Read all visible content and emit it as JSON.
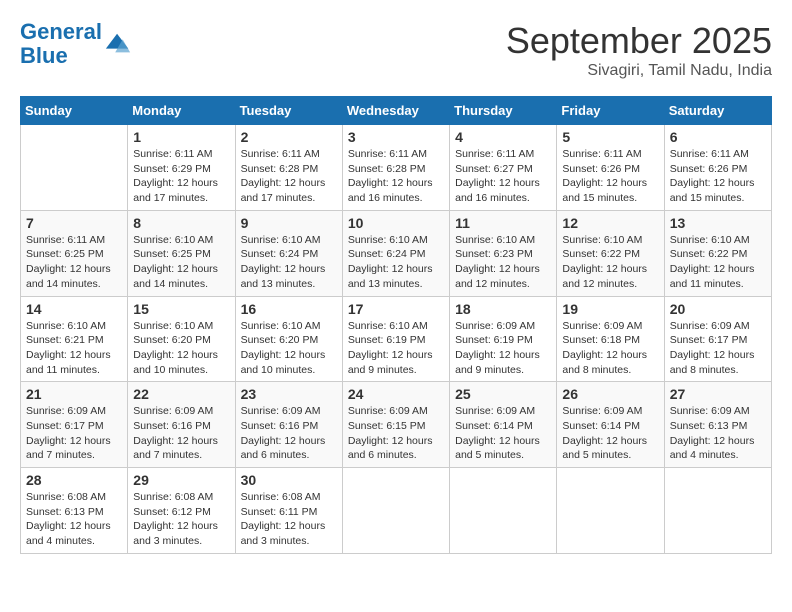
{
  "logo": {
    "line1": "General",
    "line2": "Blue"
  },
  "title": "September 2025",
  "subtitle": "Sivagiri, Tamil Nadu, India",
  "headers": [
    "Sunday",
    "Monday",
    "Tuesday",
    "Wednesday",
    "Thursday",
    "Friday",
    "Saturday"
  ],
  "weeks": [
    [
      {
        "day": "",
        "info": ""
      },
      {
        "day": "1",
        "info": "Sunrise: 6:11 AM\nSunset: 6:29 PM\nDaylight: 12 hours\nand 17 minutes."
      },
      {
        "day": "2",
        "info": "Sunrise: 6:11 AM\nSunset: 6:28 PM\nDaylight: 12 hours\nand 17 minutes."
      },
      {
        "day": "3",
        "info": "Sunrise: 6:11 AM\nSunset: 6:28 PM\nDaylight: 12 hours\nand 16 minutes."
      },
      {
        "day": "4",
        "info": "Sunrise: 6:11 AM\nSunset: 6:27 PM\nDaylight: 12 hours\nand 16 minutes."
      },
      {
        "day": "5",
        "info": "Sunrise: 6:11 AM\nSunset: 6:26 PM\nDaylight: 12 hours\nand 15 minutes."
      },
      {
        "day": "6",
        "info": "Sunrise: 6:11 AM\nSunset: 6:26 PM\nDaylight: 12 hours\nand 15 minutes."
      }
    ],
    [
      {
        "day": "7",
        "info": "Sunrise: 6:11 AM\nSunset: 6:25 PM\nDaylight: 12 hours\nand 14 minutes."
      },
      {
        "day": "8",
        "info": "Sunrise: 6:10 AM\nSunset: 6:25 PM\nDaylight: 12 hours\nand 14 minutes."
      },
      {
        "day": "9",
        "info": "Sunrise: 6:10 AM\nSunset: 6:24 PM\nDaylight: 12 hours\nand 13 minutes."
      },
      {
        "day": "10",
        "info": "Sunrise: 6:10 AM\nSunset: 6:24 PM\nDaylight: 12 hours\nand 13 minutes."
      },
      {
        "day": "11",
        "info": "Sunrise: 6:10 AM\nSunset: 6:23 PM\nDaylight: 12 hours\nand 12 minutes."
      },
      {
        "day": "12",
        "info": "Sunrise: 6:10 AM\nSunset: 6:22 PM\nDaylight: 12 hours\nand 12 minutes."
      },
      {
        "day": "13",
        "info": "Sunrise: 6:10 AM\nSunset: 6:22 PM\nDaylight: 12 hours\nand 11 minutes."
      }
    ],
    [
      {
        "day": "14",
        "info": "Sunrise: 6:10 AM\nSunset: 6:21 PM\nDaylight: 12 hours\nand 11 minutes."
      },
      {
        "day": "15",
        "info": "Sunrise: 6:10 AM\nSunset: 6:20 PM\nDaylight: 12 hours\nand 10 minutes."
      },
      {
        "day": "16",
        "info": "Sunrise: 6:10 AM\nSunset: 6:20 PM\nDaylight: 12 hours\nand 10 minutes."
      },
      {
        "day": "17",
        "info": "Sunrise: 6:10 AM\nSunset: 6:19 PM\nDaylight: 12 hours\nand 9 minutes."
      },
      {
        "day": "18",
        "info": "Sunrise: 6:09 AM\nSunset: 6:19 PM\nDaylight: 12 hours\nand 9 minutes."
      },
      {
        "day": "19",
        "info": "Sunrise: 6:09 AM\nSunset: 6:18 PM\nDaylight: 12 hours\nand 8 minutes."
      },
      {
        "day": "20",
        "info": "Sunrise: 6:09 AM\nSunset: 6:17 PM\nDaylight: 12 hours\nand 8 minutes."
      }
    ],
    [
      {
        "day": "21",
        "info": "Sunrise: 6:09 AM\nSunset: 6:17 PM\nDaylight: 12 hours\nand 7 minutes."
      },
      {
        "day": "22",
        "info": "Sunrise: 6:09 AM\nSunset: 6:16 PM\nDaylight: 12 hours\nand 7 minutes."
      },
      {
        "day": "23",
        "info": "Sunrise: 6:09 AM\nSunset: 6:16 PM\nDaylight: 12 hours\nand 6 minutes."
      },
      {
        "day": "24",
        "info": "Sunrise: 6:09 AM\nSunset: 6:15 PM\nDaylight: 12 hours\nand 6 minutes."
      },
      {
        "day": "25",
        "info": "Sunrise: 6:09 AM\nSunset: 6:14 PM\nDaylight: 12 hours\nand 5 minutes."
      },
      {
        "day": "26",
        "info": "Sunrise: 6:09 AM\nSunset: 6:14 PM\nDaylight: 12 hours\nand 5 minutes."
      },
      {
        "day": "27",
        "info": "Sunrise: 6:09 AM\nSunset: 6:13 PM\nDaylight: 12 hours\nand 4 minutes."
      }
    ],
    [
      {
        "day": "28",
        "info": "Sunrise: 6:08 AM\nSunset: 6:13 PM\nDaylight: 12 hours\nand 4 minutes."
      },
      {
        "day": "29",
        "info": "Sunrise: 6:08 AM\nSunset: 6:12 PM\nDaylight: 12 hours\nand 3 minutes."
      },
      {
        "day": "30",
        "info": "Sunrise: 6:08 AM\nSunset: 6:11 PM\nDaylight: 12 hours\nand 3 minutes."
      },
      {
        "day": "",
        "info": ""
      },
      {
        "day": "",
        "info": ""
      },
      {
        "day": "",
        "info": ""
      },
      {
        "day": "",
        "info": ""
      }
    ]
  ]
}
